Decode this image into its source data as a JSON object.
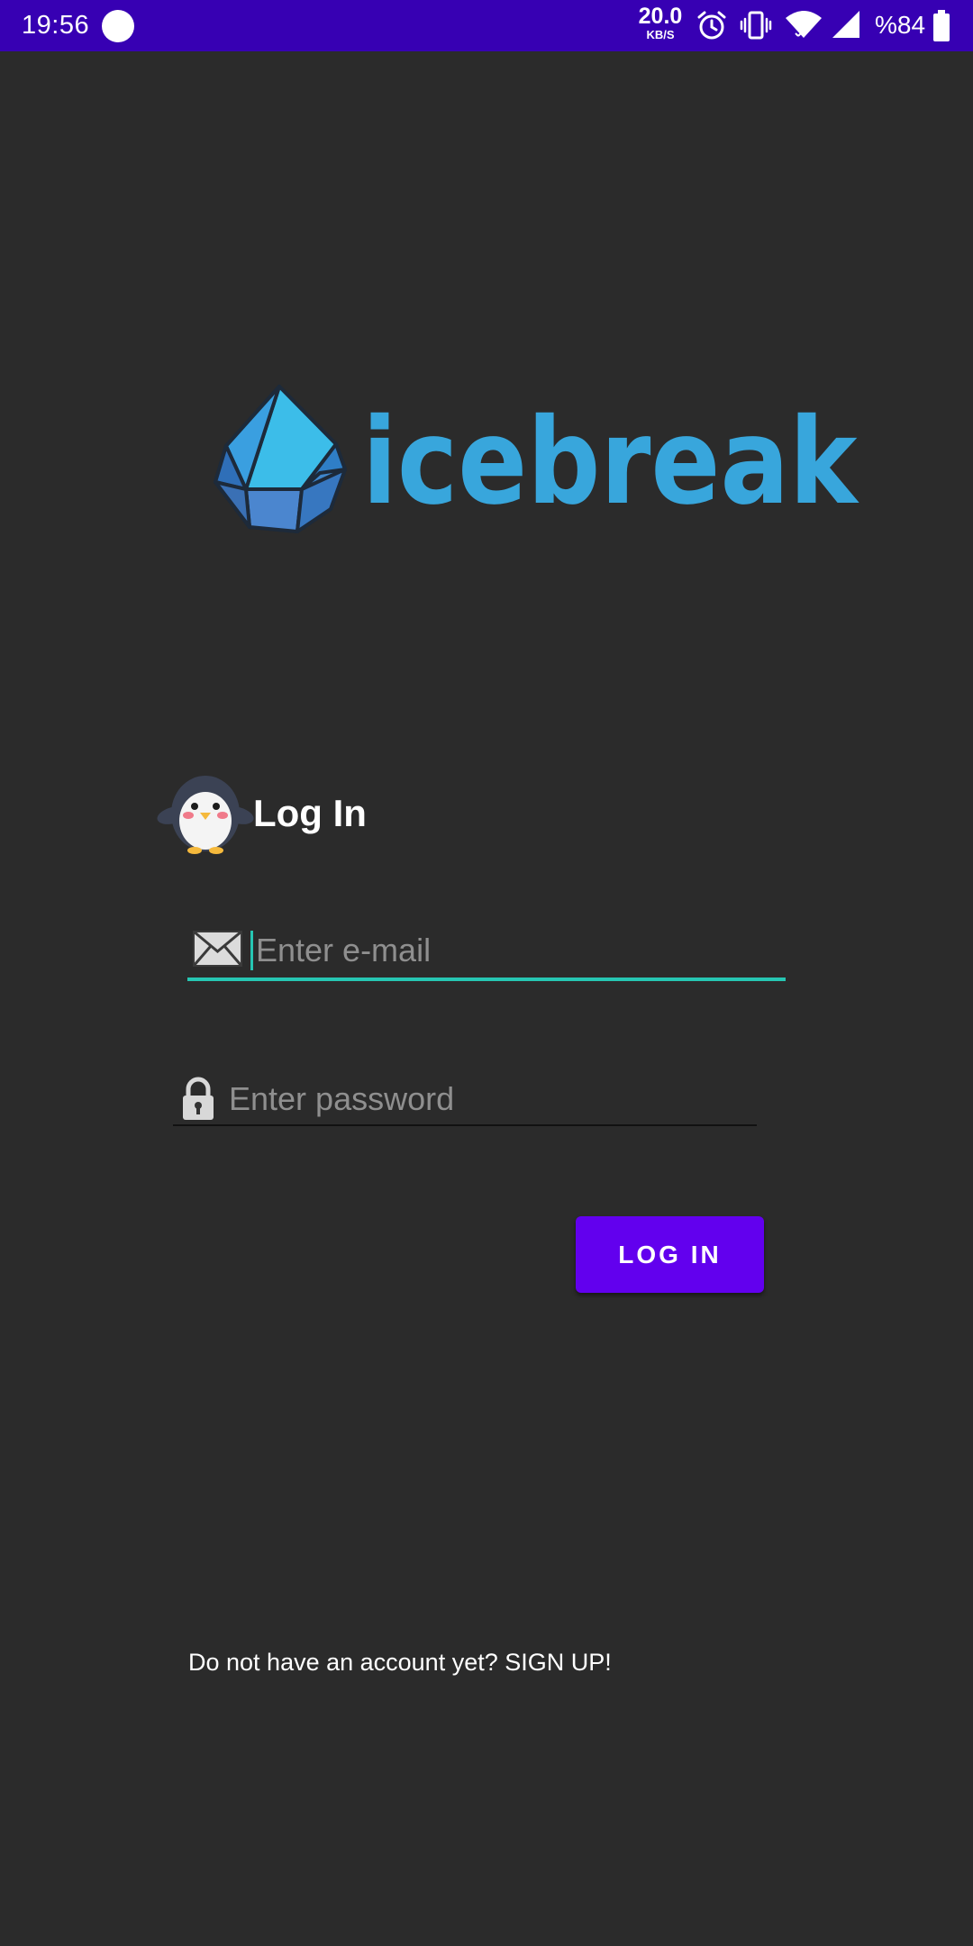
{
  "status_bar": {
    "time": "19:56",
    "network_speed_value": "20.0",
    "network_speed_unit": "KB/S",
    "battery_level": "%84",
    "icons": [
      "alarm-icon",
      "vibrate-icon",
      "wifi-icon",
      "cellular-signal-icon",
      "battery-icon"
    ],
    "background_color": "#3700b3"
  },
  "logo": {
    "text": "icebreak",
    "color": "#38a6dc"
  },
  "login": {
    "title": "Log In",
    "mascot": "penguin-icon"
  },
  "email": {
    "placeholder": "Enter e-mail",
    "value": "",
    "icon": "envelope-icon",
    "focused": true,
    "accent_color": "#26c6b3"
  },
  "password": {
    "placeholder": "Enter password",
    "value": "",
    "icon": "lock-icon"
  },
  "login_button": {
    "label": "LOG IN",
    "color": "#6200ee"
  },
  "signup": {
    "text": "Do not have an account yet? SIGN UP!"
  },
  "theme": {
    "background": "#2b2b2b"
  }
}
